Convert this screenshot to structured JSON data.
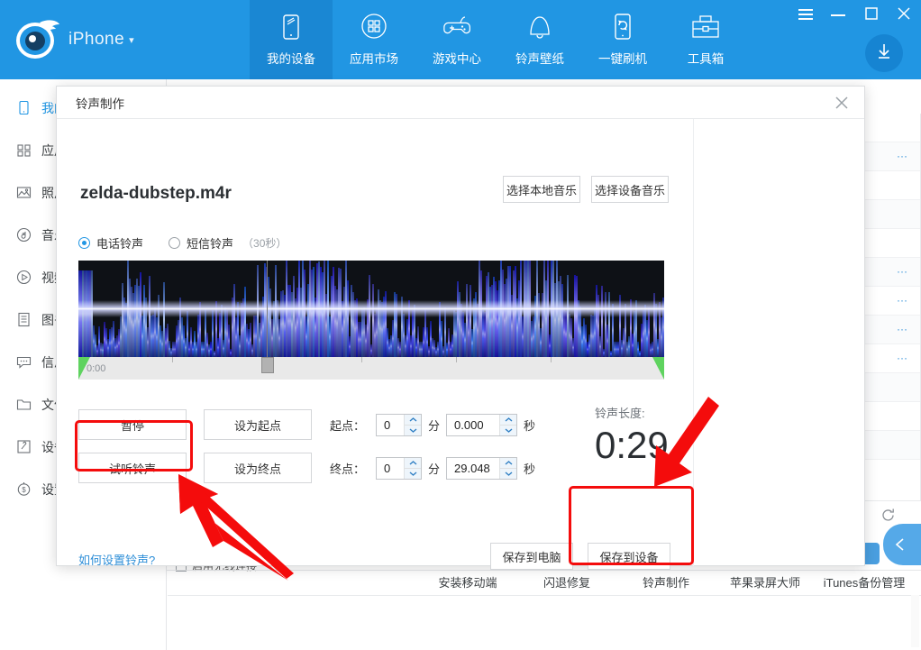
{
  "window": {
    "brand_name": "iPhone",
    "brand_caret": "▾",
    "controls": [
      "menu-icon",
      "minimize-icon",
      "maximize-icon",
      "close-icon"
    ],
    "download_icon": "download-icon"
  },
  "nav": {
    "items": [
      {
        "label": "我的设备",
        "icon": "device-icon",
        "active": true
      },
      {
        "label": "应用市场",
        "icon": "apps-grid-icon",
        "active": false
      },
      {
        "label": "游戏中心",
        "icon": "gamepad-icon",
        "active": false
      },
      {
        "label": "铃声壁纸",
        "icon": "bell-icon",
        "active": false
      },
      {
        "label": "一键刷机",
        "icon": "flash-device-icon",
        "active": false
      },
      {
        "label": "工具箱",
        "icon": "toolbox-icon",
        "active": false
      }
    ]
  },
  "sidebar": {
    "items": [
      {
        "label": "我的设备",
        "icon": "device-icon",
        "active": true
      },
      {
        "label": "应用",
        "icon": "apps-grid-icon",
        "active": false
      },
      {
        "label": "照片",
        "icon": "photo-icon",
        "active": false
      },
      {
        "label": "音乐",
        "icon": "music-icon",
        "active": false
      },
      {
        "label": "视频",
        "icon": "video-icon",
        "active": false
      },
      {
        "label": "图书",
        "icon": "book-icon",
        "active": false
      },
      {
        "label": "信息",
        "icon": "message-icon",
        "active": false
      },
      {
        "label": "文件",
        "icon": "folder-icon",
        "active": false
      },
      {
        "label": "设备信息",
        "icon": "info-icon",
        "active": false
      },
      {
        "label": "设置",
        "icon": "settings-icon",
        "active": false
      }
    ]
  },
  "background": {
    "wifi_checkbox_label": "启用无线连接",
    "refresh_icon": "refresh-icon",
    "tools": [
      {
        "label": "安装移动端",
        "color": "#4a9fe0"
      },
      {
        "label": "闪退修复",
        "color": "#4a9fe0"
      },
      {
        "label": "铃声制作",
        "color": "#4a9fe0"
      },
      {
        "label": "苹果录屏大师",
        "color": "#57b86a"
      },
      {
        "label": "iTunes备份管理",
        "color": "#4a9fe0"
      }
    ]
  },
  "modal": {
    "title": "铃声制作",
    "close_icon": "close-icon",
    "file_name": "zelda-dubstep.m4r",
    "source_buttons": [
      {
        "label": "选择本地音乐"
      },
      {
        "label": "选择设备音乐"
      }
    ],
    "ringtone_types": [
      {
        "label": "电话铃声",
        "sub": "",
        "selected": true
      },
      {
        "label": "短信铃声",
        "sub": "（30秒）",
        "selected": false
      }
    ],
    "timeline": {
      "start_time": "0:00"
    },
    "controls": [
      {
        "label": "暂停",
        "name": "pause-button"
      },
      {
        "label": "设为起点",
        "name": "set-start-button"
      },
      {
        "label": "试听铃声",
        "name": "preview-ringtone-button"
      },
      {
        "label": "设为终点",
        "name": "set-end-button"
      }
    ],
    "start": {
      "label": "起点：",
      "min": "0",
      "min_unit": "分",
      "sec": "0.000",
      "sec_unit": "秒"
    },
    "end": {
      "label": "终点：",
      "min": "0",
      "min_unit": "分",
      "sec": "29.048",
      "sec_unit": "秒"
    },
    "length": {
      "label": "铃声长度:",
      "value": "0:29"
    },
    "help_link": "如何设置铃声?",
    "save_buttons": [
      {
        "label": "保存到电脑",
        "name": "save-to-computer-button"
      },
      {
        "label": "保存到设备",
        "name": "save-to-device-button"
      }
    ]
  },
  "annotations": {
    "accent_color": "#f40c0c",
    "highlight_targets": [
      "preview-ringtone-button",
      "save-to-device-button"
    ]
  },
  "colors": {
    "brand_blue": "#2196e3",
    "brand_blue_active": "#1a87d3",
    "link_blue": "#2f8fd8",
    "annotation_red": "#f40c0c",
    "handle_green": "#5fd35f"
  }
}
